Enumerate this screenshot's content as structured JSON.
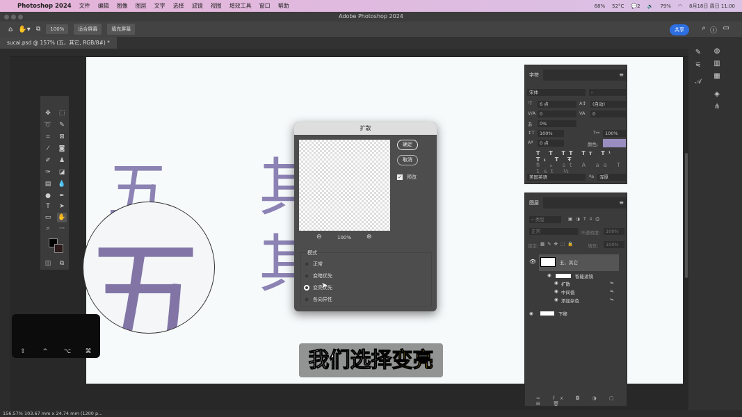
{
  "menubar": {
    "app": "Photoshop 2024",
    "items": [
      "文件",
      "编辑",
      "图像",
      "图层",
      "文字",
      "选择",
      "滤镜",
      "视图",
      "增效工具",
      "窗口",
      "帮助"
    ],
    "cpu": "68%",
    "temp": "52°C",
    "wechat_count": "2",
    "battery": "79%",
    "datetime": "8月18日 周日 11:00"
  },
  "window": {
    "title": "Adobe Photoshop 2024"
  },
  "options": {
    "zoom": "100%",
    "fit": "适合屏幕",
    "fill": "填充屏幕",
    "share": "共享"
  },
  "document": {
    "tab": "sucai.psd @ 157% (五、其它, RGB/8#) *"
  },
  "canvas": {
    "chars": [
      "五",
      "其",
      "其"
    ]
  },
  "dialog": {
    "title": "扩散",
    "ok": "确定",
    "cancel": "取消",
    "preview_label": "预览",
    "preview_checked": true,
    "zoom": "100%",
    "mode_label": "模式",
    "modes": [
      "正常",
      "变暗优先",
      "变亮优先",
      "各向异性"
    ],
    "selected_mode": "变亮优先"
  },
  "character": {
    "tab": "字符",
    "font": "宋体",
    "style": "-",
    "size": "6 点",
    "leading": "(自动)",
    "kerning": "0",
    "tracking": "0",
    "scale_v": "0%",
    "scale_h": "100%",
    "scale_w": "100%",
    "baseline": "0 点",
    "color_label": "颜色:",
    "color": "#9a8ec0",
    "language": "美国英语",
    "aa": "浑厚"
  },
  "layers": {
    "tab": "图层",
    "filter": "类型",
    "blend": "正常",
    "opacity_label": "不透明度:",
    "opacity": "100%",
    "lock_label": "锁定:",
    "fill_label": "填充:",
    "fill": "100%",
    "items": [
      {
        "name": "五、其它",
        "type": "smart"
      },
      {
        "name": "智能滤镜",
        "type": "filters"
      },
      {
        "name": "扩散",
        "type": "filter"
      },
      {
        "name": "中间值",
        "type": "filter"
      },
      {
        "name": "添加杂色",
        "type": "filter"
      },
      {
        "name": "下移",
        "type": "layer"
      }
    ]
  },
  "keys": [
    "⇧",
    "^",
    "⌥",
    "⌘"
  ],
  "subtitle": {
    "normal": "我们选择",
    "highlight": "变亮"
  },
  "status": "156.57%   103.67 mm x 24.74 mm (1200 p..."
}
